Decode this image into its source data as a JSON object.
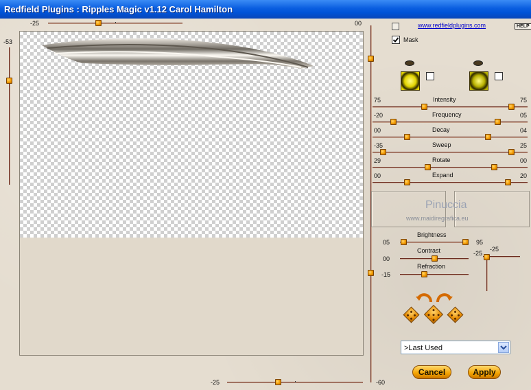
{
  "window": {
    "title": "Redfield Plugins : Ripples Magic v1.12   Carol Hamilton"
  },
  "links": {
    "website": "www.redfieldplugins.com",
    "help": "HELP"
  },
  "preview_sliders": {
    "top_left": "-25",
    "top_right": "00",
    "left_top": "-53",
    "bottom_left": "-25",
    "bottom_right": "-60"
  },
  "mask": {
    "label": "Mask",
    "checked": true
  },
  "effects": [
    {
      "label": "Intensity",
      "left": "75",
      "right": "75"
    },
    {
      "label": "Frequency",
      "left": "-20",
      "right": "05"
    },
    {
      "label": "Decay",
      "left": "00",
      "right": "04"
    },
    {
      "label": "Sweep",
      "left": "-35",
      "right": "25"
    },
    {
      "label": "Rotate",
      "left": "29",
      "right": "00"
    },
    {
      "label": "Expand",
      "left": "00",
      "right": "20"
    }
  ],
  "watermark": {
    "name": "Pinuccia",
    "site": "www.maidiregrafica.eu"
  },
  "lighting": {
    "brightness_label": "Brightness",
    "brightness_left": "05",
    "brightness_right": "95",
    "contrast_label": "Contrast",
    "contrast_value": "00",
    "refraction_label": "Refraction",
    "refraction_value": "-15",
    "side_top": "-25",
    "side_left": "-25"
  },
  "preset": {
    "selected": ">Last Used"
  },
  "buttons": {
    "cancel": "Cancel",
    "apply": "Apply"
  },
  "colors": {
    "titlebar": "#0a5ee0",
    "thumb": "#f29a00",
    "track": "#6b2b1f",
    "background": "#e5ddd0"
  }
}
